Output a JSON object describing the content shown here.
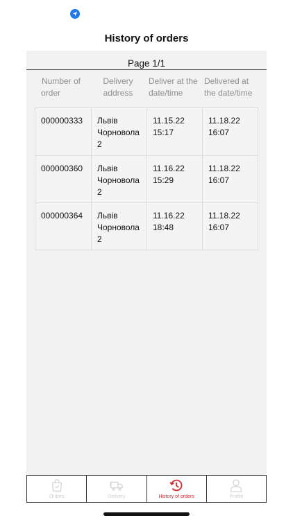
{
  "header": {
    "title": "History of orders"
  },
  "pagination": {
    "label": "Page 1/1"
  },
  "columns": {
    "order_number": [
      "Number of",
      "order"
    ],
    "delivery_address": [
      "Delivery",
      "address"
    ],
    "deliver_at": [
      "Deliver at the",
      "date/time"
    ],
    "delivered_at": [
      "Delivered at",
      "the date/time"
    ]
  },
  "orders": [
    {
      "number": "000000333",
      "address": [
        "Львів",
        "Чорновола",
        "2"
      ],
      "deliver_at": [
        "11.15.22",
        "15:17"
      ],
      "delivered_at": [
        "11.18.22",
        "16:07"
      ]
    },
    {
      "number": "000000360",
      "address": [
        "Львів",
        "Чорновола",
        "2"
      ],
      "deliver_at": [
        "11.16.22",
        "15:29"
      ],
      "delivered_at": [
        "11.18.22",
        "16:07"
      ]
    },
    {
      "number": "000000364",
      "address": [
        "Львів",
        "Чорновола",
        "2"
      ],
      "deliver_at": [
        "11.16.22",
        "18:48"
      ],
      "delivered_at": [
        "11.18.22",
        "16:07"
      ]
    }
  ],
  "tabbar": {
    "tabs": [
      {
        "label": "Orders",
        "icon": "shopping-bag-icon",
        "active": false
      },
      {
        "label": "Delivery",
        "icon": "delivery-truck-icon",
        "active": false
      },
      {
        "label": "History of orders",
        "icon": "history-clock-icon",
        "active": true
      },
      {
        "label": "Profile",
        "icon": "profile-icon",
        "active": false
      }
    ]
  },
  "colors": {
    "accent": "#d6282f",
    "location": "#1e7bf2",
    "panel": "#f2f2f2",
    "muted_text": "#8e8e8e"
  }
}
